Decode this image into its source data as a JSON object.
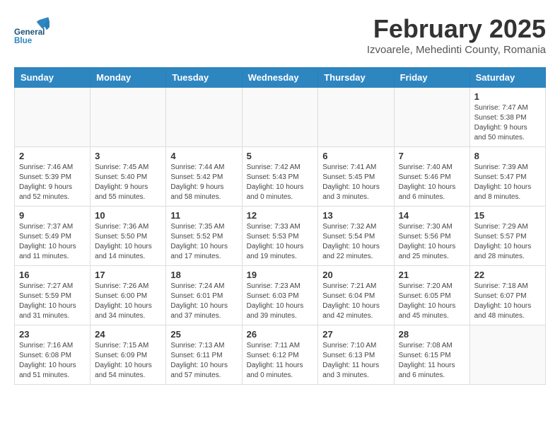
{
  "header": {
    "logo_general": "General",
    "logo_blue": "Blue",
    "month_year": "February 2025",
    "location": "Izvoarele, Mehedinti County, Romania"
  },
  "calendar": {
    "days_of_week": [
      "Sunday",
      "Monday",
      "Tuesday",
      "Wednesday",
      "Thursday",
      "Friday",
      "Saturday"
    ],
    "weeks": [
      [
        {
          "day": "",
          "info": ""
        },
        {
          "day": "",
          "info": ""
        },
        {
          "day": "",
          "info": ""
        },
        {
          "day": "",
          "info": ""
        },
        {
          "day": "",
          "info": ""
        },
        {
          "day": "",
          "info": ""
        },
        {
          "day": "1",
          "info": "Sunrise: 7:47 AM\nSunset: 5:38 PM\nDaylight: 9 hours and 50 minutes."
        }
      ],
      [
        {
          "day": "2",
          "info": "Sunrise: 7:46 AM\nSunset: 5:39 PM\nDaylight: 9 hours and 52 minutes."
        },
        {
          "day": "3",
          "info": "Sunrise: 7:45 AM\nSunset: 5:40 PM\nDaylight: 9 hours and 55 minutes."
        },
        {
          "day": "4",
          "info": "Sunrise: 7:44 AM\nSunset: 5:42 PM\nDaylight: 9 hours and 58 minutes."
        },
        {
          "day": "5",
          "info": "Sunrise: 7:42 AM\nSunset: 5:43 PM\nDaylight: 10 hours and 0 minutes."
        },
        {
          "day": "6",
          "info": "Sunrise: 7:41 AM\nSunset: 5:45 PM\nDaylight: 10 hours and 3 minutes."
        },
        {
          "day": "7",
          "info": "Sunrise: 7:40 AM\nSunset: 5:46 PM\nDaylight: 10 hours and 6 minutes."
        },
        {
          "day": "8",
          "info": "Sunrise: 7:39 AM\nSunset: 5:47 PM\nDaylight: 10 hours and 8 minutes."
        }
      ],
      [
        {
          "day": "9",
          "info": "Sunrise: 7:37 AM\nSunset: 5:49 PM\nDaylight: 10 hours and 11 minutes."
        },
        {
          "day": "10",
          "info": "Sunrise: 7:36 AM\nSunset: 5:50 PM\nDaylight: 10 hours and 14 minutes."
        },
        {
          "day": "11",
          "info": "Sunrise: 7:35 AM\nSunset: 5:52 PM\nDaylight: 10 hours and 17 minutes."
        },
        {
          "day": "12",
          "info": "Sunrise: 7:33 AM\nSunset: 5:53 PM\nDaylight: 10 hours and 19 minutes."
        },
        {
          "day": "13",
          "info": "Sunrise: 7:32 AM\nSunset: 5:54 PM\nDaylight: 10 hours and 22 minutes."
        },
        {
          "day": "14",
          "info": "Sunrise: 7:30 AM\nSunset: 5:56 PM\nDaylight: 10 hours and 25 minutes."
        },
        {
          "day": "15",
          "info": "Sunrise: 7:29 AM\nSunset: 5:57 PM\nDaylight: 10 hours and 28 minutes."
        }
      ],
      [
        {
          "day": "16",
          "info": "Sunrise: 7:27 AM\nSunset: 5:59 PM\nDaylight: 10 hours and 31 minutes."
        },
        {
          "day": "17",
          "info": "Sunrise: 7:26 AM\nSunset: 6:00 PM\nDaylight: 10 hours and 34 minutes."
        },
        {
          "day": "18",
          "info": "Sunrise: 7:24 AM\nSunset: 6:01 PM\nDaylight: 10 hours and 37 minutes."
        },
        {
          "day": "19",
          "info": "Sunrise: 7:23 AM\nSunset: 6:03 PM\nDaylight: 10 hours and 39 minutes."
        },
        {
          "day": "20",
          "info": "Sunrise: 7:21 AM\nSunset: 6:04 PM\nDaylight: 10 hours and 42 minutes."
        },
        {
          "day": "21",
          "info": "Sunrise: 7:20 AM\nSunset: 6:05 PM\nDaylight: 10 hours and 45 minutes."
        },
        {
          "day": "22",
          "info": "Sunrise: 7:18 AM\nSunset: 6:07 PM\nDaylight: 10 hours and 48 minutes."
        }
      ],
      [
        {
          "day": "23",
          "info": "Sunrise: 7:16 AM\nSunset: 6:08 PM\nDaylight: 10 hours and 51 minutes."
        },
        {
          "day": "24",
          "info": "Sunrise: 7:15 AM\nSunset: 6:09 PM\nDaylight: 10 hours and 54 minutes."
        },
        {
          "day": "25",
          "info": "Sunrise: 7:13 AM\nSunset: 6:11 PM\nDaylight: 10 hours and 57 minutes."
        },
        {
          "day": "26",
          "info": "Sunrise: 7:11 AM\nSunset: 6:12 PM\nDaylight: 11 hours and 0 minutes."
        },
        {
          "day": "27",
          "info": "Sunrise: 7:10 AM\nSunset: 6:13 PM\nDaylight: 11 hours and 3 minutes."
        },
        {
          "day": "28",
          "info": "Sunrise: 7:08 AM\nSunset: 6:15 PM\nDaylight: 11 hours and 6 minutes."
        },
        {
          "day": "",
          "info": ""
        }
      ]
    ]
  }
}
